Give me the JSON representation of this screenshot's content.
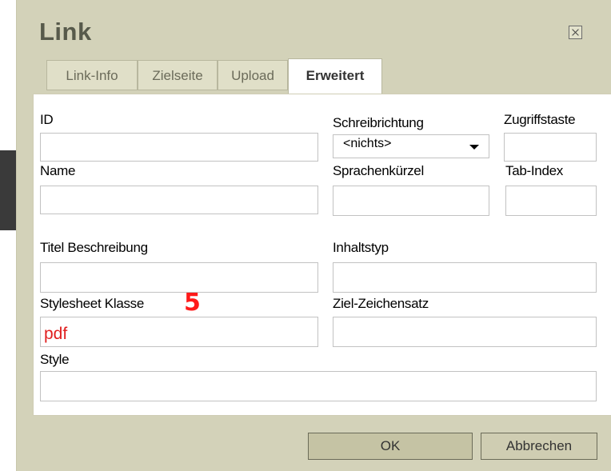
{
  "dialog": {
    "title": "Link",
    "close_icon": "close-x-icon"
  },
  "tabs": [
    {
      "label": "Link-Info",
      "active": false
    },
    {
      "label": "Zielseite",
      "active": false
    },
    {
      "label": "Upload",
      "active": false
    },
    {
      "label": "Erweitert",
      "active": true
    }
  ],
  "fields": {
    "id": {
      "label": "ID",
      "value": ""
    },
    "schreibrichtung": {
      "label": "Schreibrichtung",
      "value": "<nichts>"
    },
    "zugriffstaste": {
      "label": "Zugriffstaste",
      "value": ""
    },
    "name": {
      "label": "Name",
      "value": ""
    },
    "sprachenkuerzel": {
      "label": "Sprachenkürzel",
      "value": ""
    },
    "tab_index": {
      "label": "Tab-Index",
      "value": ""
    },
    "titel_beschreibung": {
      "label": "Titel Beschreibung",
      "value": ""
    },
    "inhaltstyp": {
      "label": "Inhaltstyp",
      "value": ""
    },
    "stylesheet_klasse": {
      "label": "Stylesheet Klasse",
      "value": "pdf"
    },
    "ziel_zeichensatz": {
      "label": "Ziel-Zeichensatz",
      "value": ""
    },
    "style": {
      "label": "Style",
      "value": ""
    }
  },
  "annotation": {
    "marker": "5",
    "color": "#ff1a1a"
  },
  "buttons": {
    "ok": "OK",
    "cancel": "Abbrechen"
  },
  "colors": {
    "dialog_bg": "#d3d2b9",
    "panel_bg": "#ffffff",
    "title": "#575a4b",
    "highlight_text": "#e01f1f"
  }
}
